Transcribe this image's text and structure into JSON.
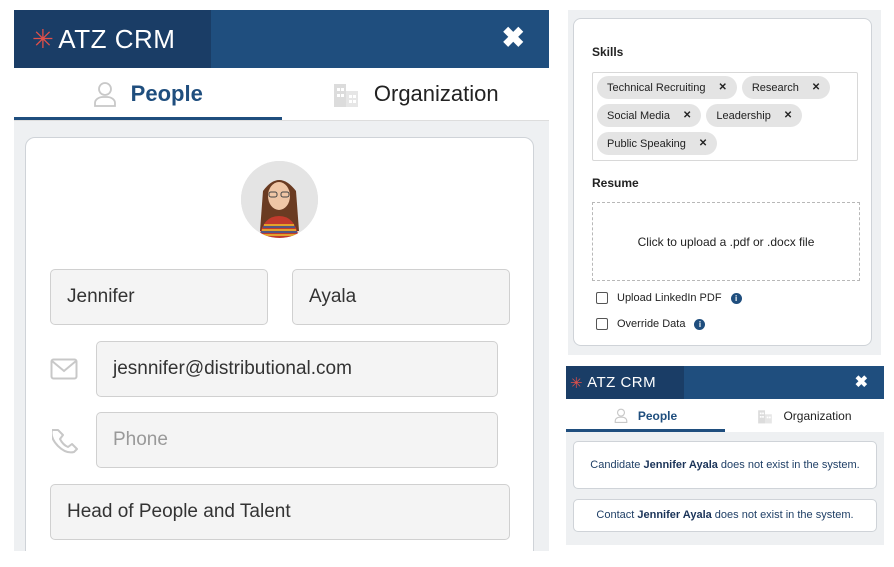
{
  "app": {
    "brand": "ATZ CRM",
    "close_icon": "close-icon"
  },
  "tabs": [
    {
      "label": "People",
      "icon": "person-icon",
      "active": true
    },
    {
      "label": "Organization",
      "icon": "building-icon",
      "active": false
    }
  ],
  "person_form": {
    "first_name": "Jennifer",
    "last_name": "Ayala",
    "email": "jesnnifer@distributional.com",
    "phone_placeholder": "Phone",
    "title": "Head of People and Talent"
  },
  "profile": {
    "skills_label": "Skills",
    "skills": [
      "Technical Recruiting",
      "Research",
      "Social Media",
      "Leadership",
      "Public Speaking"
    ],
    "resume_label": "Resume",
    "upload_text": "Click to upload a .pdf or .docx file",
    "checkboxes": [
      {
        "label": "Upload LinkedIn PDF",
        "checked": false
      },
      {
        "label": "Override Data",
        "checked": false
      }
    ]
  },
  "status": {
    "candidate_pre": "Candidate ",
    "candidate_name": "Jennifer Ayala",
    "candidate_post": " does not exist in the system.",
    "contact_pre": "Contact ",
    "contact_name": "Jennifer Ayala",
    "contact_post": " does not exist in the system."
  },
  "colors": {
    "header": "#1f4e7e",
    "brand_bg": "#1a3d66",
    "accent_star": "#e0504a"
  }
}
